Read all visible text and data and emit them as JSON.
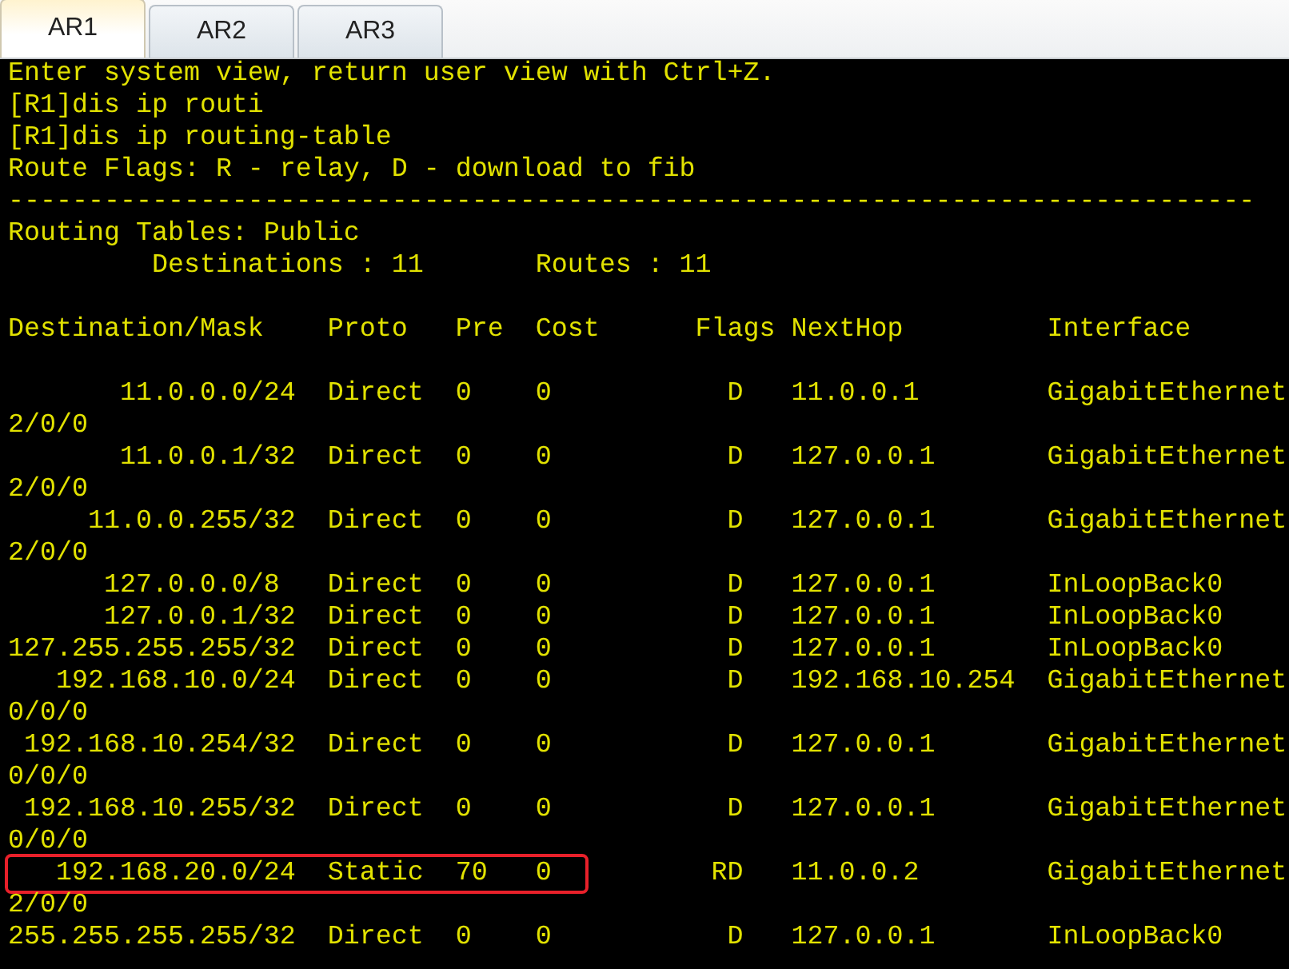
{
  "tabs": [
    {
      "label": "AR1",
      "selected": true
    },
    {
      "label": "AR2",
      "selected": false
    },
    {
      "label": "AR3",
      "selected": false
    }
  ],
  "terminal": {
    "lines": [
      {
        "kind": "text",
        "text": "Enter system view, return user view with Ctrl+Z."
      },
      {
        "kind": "text",
        "text": "[R1]dis ip routi"
      },
      {
        "kind": "text",
        "text": "[R1]dis ip routing-table"
      },
      {
        "kind": "text",
        "text": "Route Flags: R - relay, D - download to fib"
      },
      {
        "kind": "text",
        "text": "------------------------------------------------------------------------------"
      },
      {
        "kind": "text",
        "text": "Routing Tables: Public"
      },
      {
        "kind": "text",
        "text": "         Destinations : 11       Routes : 11"
      },
      {
        "kind": "blank"
      },
      {
        "kind": "text",
        "text": "Destination/Mask    Proto   Pre  Cost      Flags NextHop         Interface"
      },
      {
        "kind": "blank"
      },
      {
        "kind": "text",
        "text": "       11.0.0.0/24  Direct  0    0           D   11.0.0.1        GigabitEthernet"
      },
      {
        "kind": "text",
        "text": "2/0/0"
      },
      {
        "kind": "text",
        "text": "       11.0.0.1/32  Direct  0    0           D   127.0.0.1       GigabitEthernet"
      },
      {
        "kind": "text",
        "text": "2/0/0"
      },
      {
        "kind": "text",
        "text": "     11.0.0.255/32  Direct  0    0           D   127.0.0.1       GigabitEthernet"
      },
      {
        "kind": "text",
        "text": "2/0/0"
      },
      {
        "kind": "text",
        "text": "      127.0.0.0/8   Direct  0    0           D   127.0.0.1       InLoopBack0"
      },
      {
        "kind": "text",
        "text": "      127.0.0.1/32  Direct  0    0           D   127.0.0.1       InLoopBack0"
      },
      {
        "kind": "text",
        "text": "127.255.255.255/32  Direct  0    0           D   127.0.0.1       InLoopBack0"
      },
      {
        "kind": "text",
        "text": "   192.168.10.0/24  Direct  0    0           D   192.168.10.254  GigabitEthernet"
      },
      {
        "kind": "text",
        "text": "0/0/0"
      },
      {
        "kind": "text",
        "text": " 192.168.10.254/32  Direct  0    0           D   127.0.0.1       GigabitEthernet"
      },
      {
        "kind": "text",
        "text": "0/0/0"
      },
      {
        "kind": "text",
        "text": " 192.168.10.255/32  Direct  0    0           D   127.0.0.1       GigabitEthernet"
      },
      {
        "kind": "text",
        "text": "0/0/0"
      },
      {
        "kind": "text",
        "text": "   192.168.20.0/24  Static  70   0          RD   11.0.0.2        GigabitEthernet",
        "highlighted": true
      },
      {
        "kind": "text",
        "text": "2/0/0"
      },
      {
        "kind": "text",
        "text": "255.255.255.255/32  Direct  0    0           D   127.0.0.1       InLoopBack0"
      }
    ]
  }
}
